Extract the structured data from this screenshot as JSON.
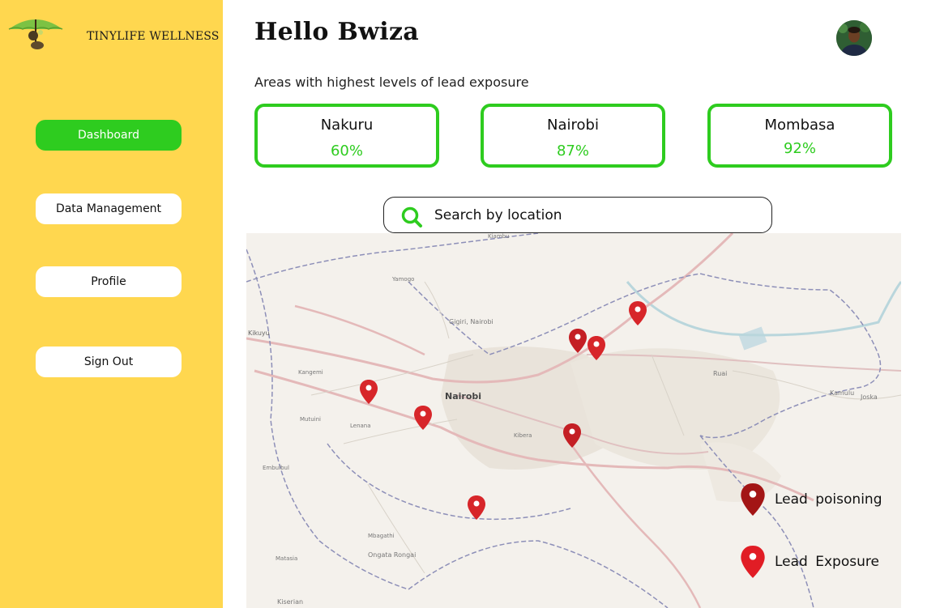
{
  "sidebar": {
    "brand": "TINYLIFE WELLNESS",
    "items": [
      {
        "label": "Dashboard",
        "active": true
      },
      {
        "label": "Data Management",
        "active": false
      },
      {
        "label": "Profile",
        "active": false
      },
      {
        "label": "Sign Out",
        "active": false
      }
    ]
  },
  "header": {
    "greeting": "Hello Bwiza"
  },
  "summary": {
    "title": "Areas with highest levels of lead exposure",
    "cards": [
      {
        "city": "Nakuru",
        "value": "60%"
      },
      {
        "city": "Nairobi",
        "value": "87%"
      },
      {
        "city": "Mombasa",
        "value": "92%"
      }
    ]
  },
  "search": {
    "placeholder": "Search by location",
    "icon": "search-icon"
  },
  "map": {
    "center_label": "Nairobi",
    "labels": {
      "kikuyu": "Kikuyu",
      "gigiri": "Gigiri, Nairobi",
      "yamogo": "Yamogo",
      "kangemi": "Kangemi",
      "lenana": "Lenana",
      "mutuini": "Mutuini",
      "kibera": "Kibera",
      "ruai": "Ruai",
      "kamulu": "Kamulu",
      "joska": "Joska",
      "mbagathi": "Mbagathi",
      "ongata": "Ongata Rongai",
      "matasia": "Matasia",
      "kiserian": "Kiserian",
      "embulbul": "Embulbul",
      "kiambu": "Kiambu"
    }
  },
  "legend": {
    "items": [
      {
        "label": "Lead  poisoning",
        "color": "#a31515"
      },
      {
        "label": "Lead  Exposure",
        "color": "#e11d25"
      }
    ]
  },
  "colors": {
    "sidebar_bg": "#ffd74f",
    "accent_green": "#2ecc1f",
    "marker_red": "#d7262a"
  }
}
